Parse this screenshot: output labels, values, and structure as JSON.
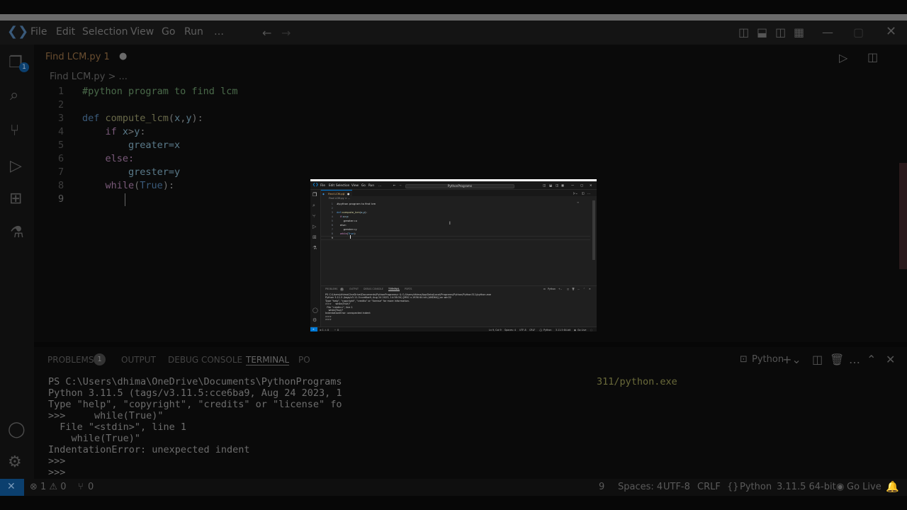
{
  "menu": [
    "File",
    "Edit",
    "Selection",
    "View",
    "Go",
    "Run",
    "…"
  ],
  "search_placeholder": "PythonPrograms",
  "tab": {
    "filename": "Find LCM.py",
    "problems": "1"
  },
  "breadcrumb": {
    "file": "Find LCM.py",
    "sep": "> ..."
  },
  "code": [
    {
      "n": "1",
      "text": "#python program to find lcm"
    },
    {
      "n": "2",
      "text": ""
    },
    {
      "n": "3",
      "text": "def compute_lcm(x,y):"
    },
    {
      "n": "4",
      "text": "    if x>y:"
    },
    {
      "n": "5",
      "text": "        greater=x"
    },
    {
      "n": "6",
      "text": "    else:"
    },
    {
      "n": "7",
      "text": "        grester=y"
    },
    {
      "n": "8",
      "text": "    while(True):"
    },
    {
      "n": "9",
      "text": "        "
    }
  ],
  "panel": {
    "tabs": [
      "PROBLEMS",
      "OUTPUT",
      "DEBUG CONSOLE",
      "TERMINAL",
      "PORTS"
    ],
    "problems_count": "1",
    "active": "TERMINAL",
    "shell": "Python"
  },
  "terminal": [
    "PS C:\\Users\\dhima\\OneDrive\\Documents\\PythonPrograms> & C:/Users/dhima/AppData/Local/Programs/Python/Python311/python.exe",
    "Python 3.11.5 (tags/v3.11.5:cce6ba9, Aug 24 2023, 14:38:34) [MSC v.1936 64 bit (AMD64)] on win32",
    "Type \"help\", \"copyright\", \"credits\" or \"license\" for more information.",
    ">>>     while(True)\"",
    "  File \"<stdin>\", line 1",
    "    while(True)\"",
    "IndentationError: unexpected indent",
    ">>>",
    ">>>"
  ],
  "bg": {
    "tab_label": "Find LCM.py 1",
    "crumb": "Find LCM.py > ...",
    "panel_tabs": [
      "PROBLEMS",
      "OUTPUT",
      "DEBUG CONSOLE",
      "TERMINAL",
      "PO"
    ],
    "problems_count": "1",
    "shell": "Python",
    "terminal_right": "311/python.exe",
    "terminal": [
      "PS C:\\Users\\dhima\\OneDrive\\Documents\\PythonPrograms",
      "Python 3.11.5 (tags/v3.11.5:cce6ba9, Aug 24 2023, 1",
      "Type \"help\", \"copyright\", \"credits\" or \"license\" fo",
      ">>>     while(True)\"",
      "  File \"<stdin>\", line 1",
      "    while(True)\"",
      "IndentationError: unexpected indent",
      ">>>",
      ">>>"
    ],
    "status_left": "⊗ 1 ⚠ 0",
    "status_ports": "0",
    "status_right": [
      "9",
      "Spaces: 4",
      "UTF-8",
      "CRLF",
      "Python",
      "3.11.5 64-bit",
      "Go Live"
    ]
  },
  "status": {
    "errors": "⊗ 1 ⚠ 0",
    "ports": "0",
    "cursor": "Ln 9, Col 9",
    "spaces": "Spaces: 4",
    "encoding": "UTF-8",
    "eol": "CRLF",
    "lang": "Python",
    "interp": "3.11.5 64-bit",
    "live": "Go Live"
  }
}
